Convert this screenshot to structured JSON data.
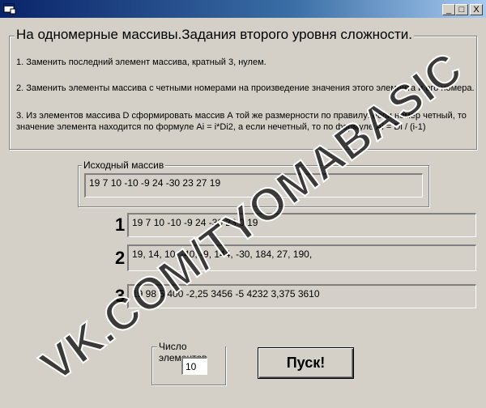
{
  "window": {
    "title": ""
  },
  "titlebar_buttons": {
    "minimize": "_",
    "maximize": "□",
    "close": "X"
  },
  "task": {
    "title": "На одномерные массивы.Задания второго уровня сложности.",
    "lines": [
      "1.      Заменить последний элемент массива, кратный 3, нулем.",
      "2.      Заменить элементы массива с четными номерами на произведение значения этого элемента и его номера.",
      "3.      Из элементов массива D сформировать массив А  той же размерности по правилу: если номер четный, то",
      "значение элемента находится по формуле Ai = i*Di2,  а  если нечетный, то по формуле Ai = Di / (i-1)"
    ]
  },
  "source": {
    "label": "Исходный массив",
    "value": "19  7  10 -10 -9  24 -30  23  27  19"
  },
  "results": [
    {
      "number": "1",
      "value": "19  7  10 -10 -9  24 -30  23  0  19"
    },
    {
      "number": "2",
      "value": "  19,   14,   10,   -40,   -9,   144,   -30,   184,   27,   190,"
    },
    {
      "number": "3",
      "value": "19  98  5  400 -2,25  3456 -5  4232  3,375  3610"
    }
  ],
  "count": {
    "label": "Число элементов",
    "value": "10"
  },
  "run_button": {
    "label": "Пуск!"
  },
  "watermark": "VK.COM/TYOMABASIC",
  "colors": {
    "window_bg": "#d4d0c8",
    "titlebar": "#0a246a"
  }
}
